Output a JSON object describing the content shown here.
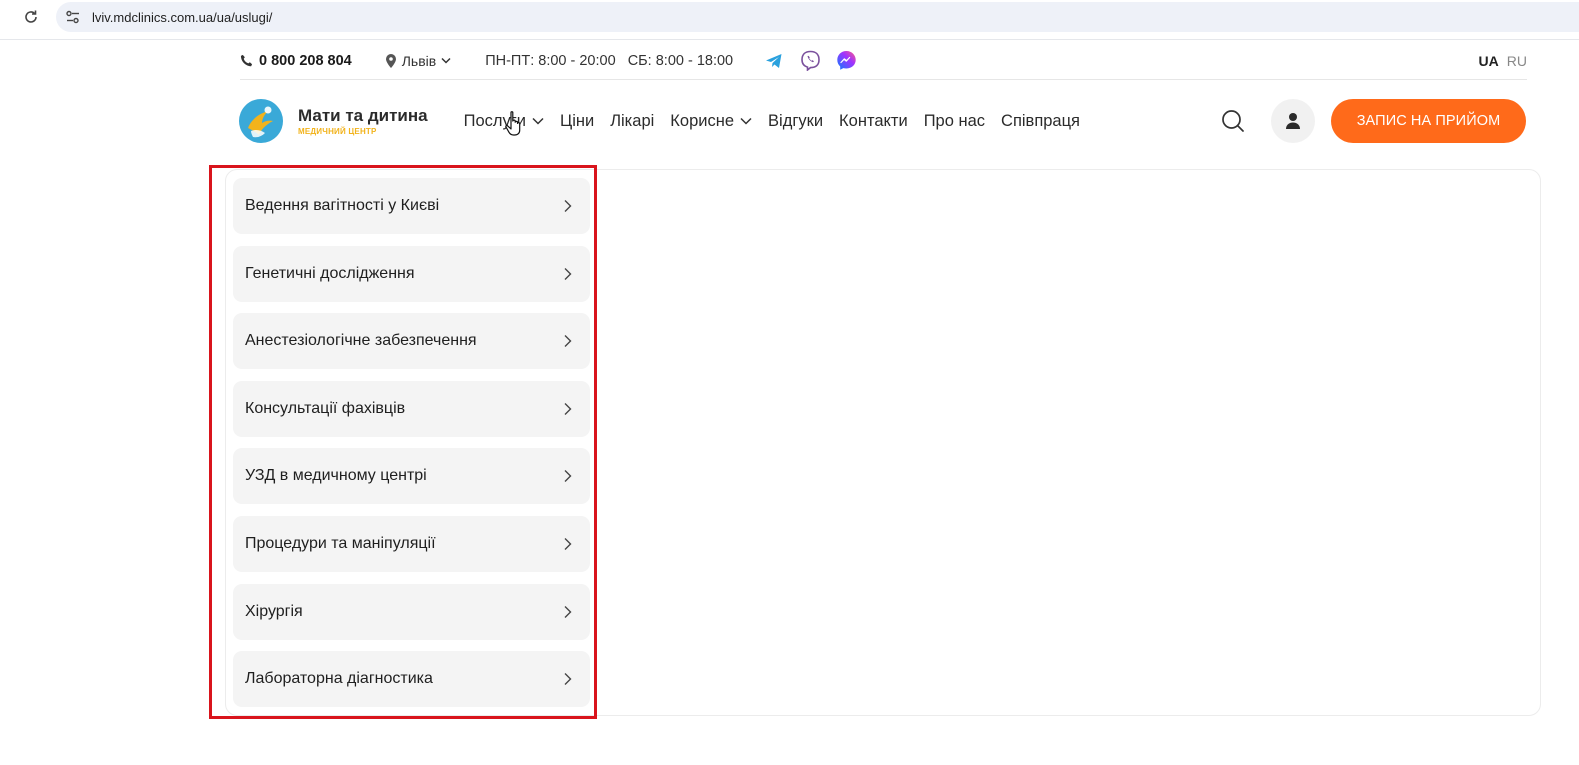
{
  "browser": {
    "url": "lviv.mdclinics.com.ua/ua/uslugi/",
    "reload_icon": "reload-icon",
    "site_info_icon": "tune-icon"
  },
  "topbar": {
    "phone": "0 800 208 804",
    "city": "Львів",
    "hours_weekdays": "ПН-ПТ: 8:00 - 20:00",
    "hours_saturday": "СБ: 8:00 - 18:00",
    "socials": [
      "telegram-icon",
      "viber-icon",
      "messenger-icon"
    ],
    "languages": [
      "UA",
      "RU"
    ],
    "active_language": "UA"
  },
  "header": {
    "logo_title": "Мати та дитина",
    "logo_subtitle": "МЕДИЧНИЙ ЦЕНТР",
    "nav": [
      {
        "label": "Послуги",
        "has_dropdown": true
      },
      {
        "label": "Ціни",
        "has_dropdown": false
      },
      {
        "label": "Лікарі",
        "has_dropdown": false
      },
      {
        "label": "Корисне",
        "has_dropdown": true
      },
      {
        "label": "Відгуки",
        "has_dropdown": false
      },
      {
        "label": "Контакти",
        "has_dropdown": false
      },
      {
        "label": "Про нас",
        "has_dropdown": false
      },
      {
        "label": "Співпраця",
        "has_dropdown": false
      }
    ],
    "cta_label": "ЗАПИС НА ПРИЙОМ"
  },
  "services_menu": {
    "items": [
      "Ведення вагітності у Києві",
      "Генетичні дослідження",
      "Анестезіологічне забезпечення",
      "Консультації фахівців",
      "УЗД в медичному центрі",
      "Процедури та маніпуляції",
      "Хірургія",
      "Лабораторна діагностика"
    ]
  },
  "colors": {
    "accent": "#ff6a1a",
    "highlight_border": "#d9141c",
    "menu_item_bg": "#f4f4f4",
    "logo_blue": "#3aa9d8",
    "logo_yellow": "#f2b31c"
  }
}
